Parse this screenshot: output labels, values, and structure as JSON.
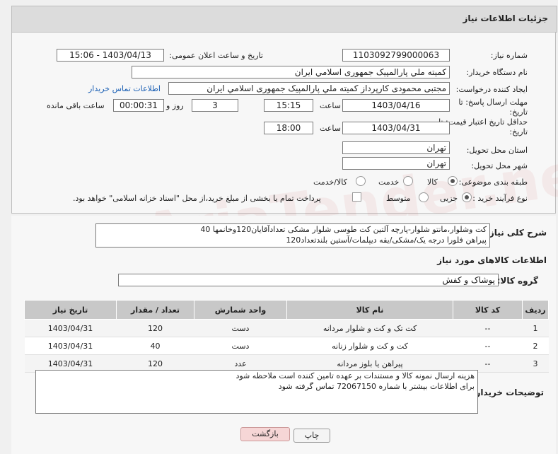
{
  "header": {
    "title": "جزئیات اطلاعات نیاز"
  },
  "fields": {
    "need_number_label": "شماره نیاز:",
    "need_number": "1103092799000063",
    "announce_label": "تاریخ و ساعت اعلان عمومی:",
    "announce_value": "1403/04/13 - 15:06",
    "buyer_label": "نام دستگاه خریدار:",
    "buyer": "کمیته ملي پارالمپیک جمهوری اسلامي ایران",
    "creator_label": "ایجاد کننده درخواست:",
    "creator": "مجتبی محمودی کارپرداز کمیته ملي پارالمپیک جمهوری اسلامي ایران",
    "contact_link": "اطلاعات تماس خریدار",
    "send_deadline_label": "مهلت ارسال پاسخ: تا تاریخ:",
    "send_date": "1403/04/16",
    "time_label": "ساعت",
    "send_time": "15:15",
    "days": "3",
    "days_label": "روز و",
    "remaining": "00:00:31",
    "remaining_label": "ساعت باقی مانده",
    "price_valid_label": "حداقل تاریخ اعتبار قیمت: تا تاریخ:",
    "price_date": "1403/04/31",
    "price_time": "18:00",
    "province_label": "استان محل تحویل:",
    "province": "تهران",
    "city_label": "شهر محل تحویل:",
    "city": "تهران",
    "category_label": "طبقه بندی موضوعی:",
    "cat_goods": "کالا",
    "cat_service": "خدمت",
    "cat_both": "کالا/خدمت",
    "process_label": "نوع فرآیند خرید :",
    "proc_minor": "جزیی",
    "proc_medium": "متوسط",
    "proc_note": "پرداخت تمام یا بخشی از مبلغ خرید،از محل \"اسناد خزانه اسلامی\" خواهد بود."
  },
  "description": {
    "label": "شرح کلی نیاز:",
    "line1": "کت وشلوار،مانتو شلوار-پارچه آلتین کت طوسی شلوار مشکی تعدادآقایان120وخانمها 40",
    "line2": "پیراهن فلورا درجه یک/مشکی/یقه دیپلمات/آستین بلندتعداد120"
  },
  "goods_info_title": "اطلاعات کالاهای مورد نیاز",
  "group": {
    "label": "گروه کالا:",
    "value": "پوشاک و کفش"
  },
  "table": {
    "headers": [
      "ردیف",
      "کد کالا",
      "نام کالا",
      "واحد شمارش",
      "تعداد / مقدار",
      "تاریخ نیاز"
    ],
    "rows": [
      [
        "1",
        "--",
        "کت تک و کت و شلوار مردانه",
        "دست",
        "120",
        "1403/04/31"
      ],
      [
        "2",
        "--",
        "کت و کت و شلوار زنانه",
        "دست",
        "40",
        "1403/04/31"
      ],
      [
        "3",
        "--",
        "پیراهن یا بلوز مردانه",
        "عدد",
        "120",
        "1403/04/31"
      ]
    ]
  },
  "buyer_notes": {
    "label": "توضیحات خریدار:",
    "line1": "هزینه ارسال نمونه کالا و مستندات بر عهده تامین کننده است ملاحظه شود",
    "line2": "برای اطلاعات بیشتر با شماره 72067150 تماس گرفته شود"
  },
  "buttons": {
    "print": "چاپ",
    "back": "بازگشت"
  },
  "watermark": "AriaTender.net"
}
